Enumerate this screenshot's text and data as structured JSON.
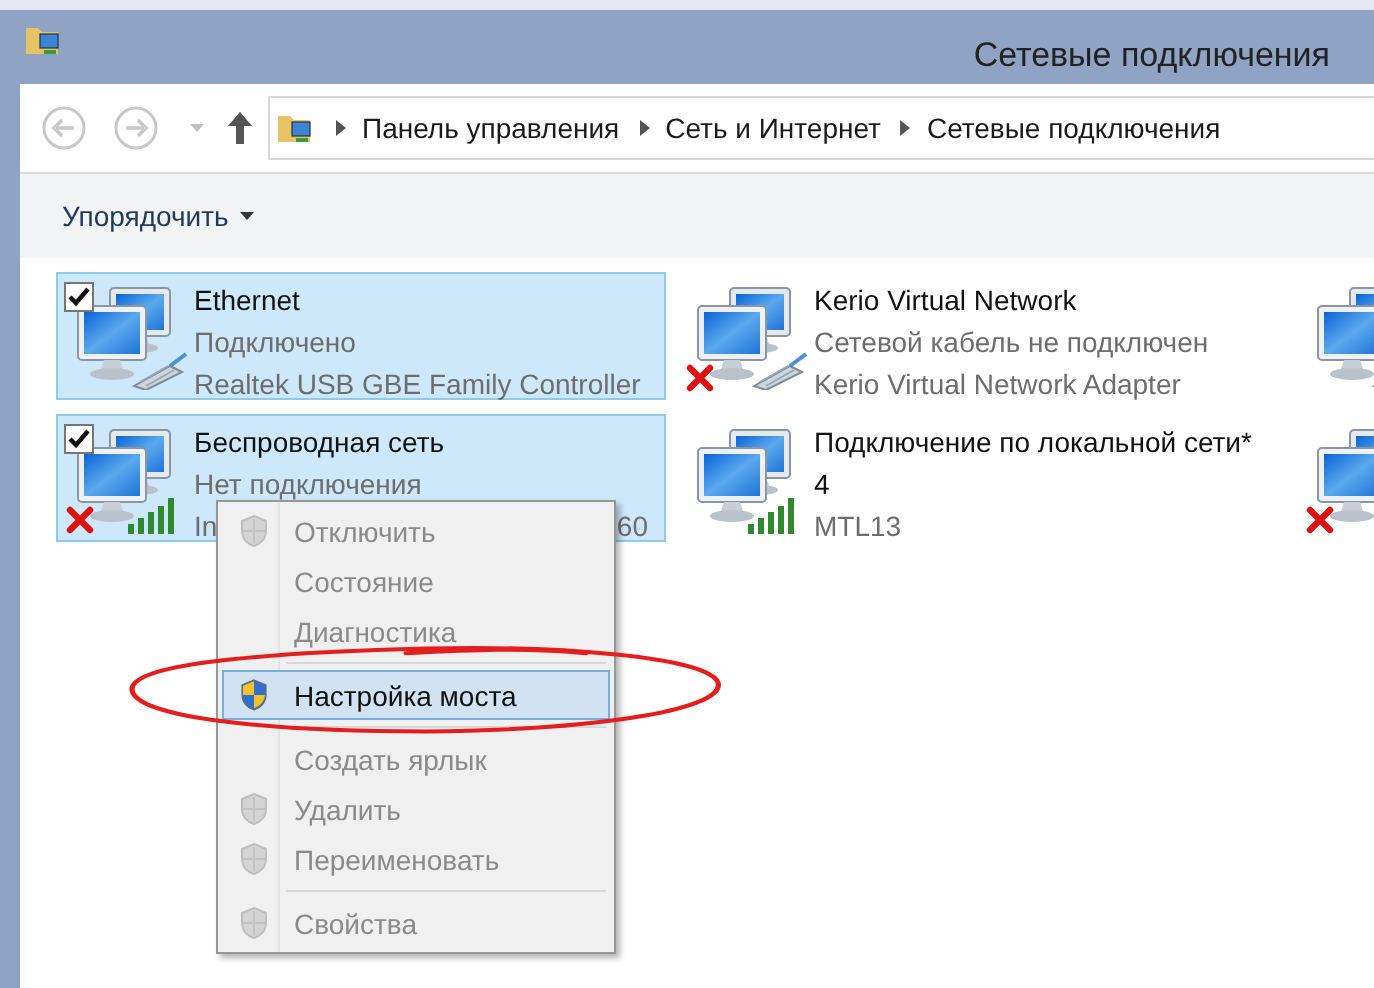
{
  "window": {
    "title": "Сетевые подключения"
  },
  "address_bar": {
    "crumbs": [
      "Панель управления",
      "Сеть и Интернет",
      "Сетевые подключения"
    ]
  },
  "toolbar": {
    "organize": "Упорядочить"
  },
  "connections": [
    {
      "name": "Ethernet",
      "status": "Подключено",
      "device": "Realtek USB GBE Family Controller",
      "kind": "cable",
      "selected": true,
      "checked": true,
      "error": false
    },
    {
      "name": "Kerio Virtual Network",
      "status": "Сетевой кабель не подключен",
      "device": "Kerio Virtual Network Adapter",
      "kind": "cable",
      "selected": false,
      "checked": false,
      "error": true
    },
    {
      "kind": "cable",
      "selected": false,
      "checked": false,
      "error": false
    },
    {
      "name": "Беспроводная сеть",
      "status": "Нет подключения",
      "device": "In",
      "device_tail": "60",
      "kind": "wifi",
      "selected": true,
      "checked": true,
      "error": true
    },
    {
      "name": "Подключение по локальной сети* 4",
      "status": "MTL13",
      "kind": "wifi",
      "selected": false,
      "checked": false,
      "error": false
    },
    {
      "kind": "unknown",
      "selected": false,
      "checked": false,
      "error": true
    }
  ],
  "context_menu": {
    "items": [
      {
        "kind": "item",
        "label": "Отключить",
        "shield": true,
        "disabled": true,
        "selected": false
      },
      {
        "kind": "item",
        "label": "Состояние",
        "shield": false,
        "disabled": true,
        "selected": false
      },
      {
        "kind": "item",
        "label": "Диагностика",
        "shield": false,
        "disabled": true,
        "selected": false
      },
      {
        "kind": "separator"
      },
      {
        "kind": "item",
        "label": "Настройка моста",
        "shield": true,
        "disabled": false,
        "selected": true
      },
      {
        "kind": "separator"
      },
      {
        "kind": "item",
        "label": "Создать ярлык",
        "shield": false,
        "disabled": true,
        "selected": false
      },
      {
        "kind": "item",
        "label": "Удалить",
        "shield": true,
        "disabled": true,
        "selected": false
      },
      {
        "kind": "item",
        "label": "Переименовать",
        "shield": true,
        "disabled": true,
        "selected": false
      },
      {
        "kind": "separator"
      },
      {
        "kind": "item",
        "label": "Свойства",
        "shield": true,
        "disabled": true,
        "selected": false
      }
    ]
  },
  "annotation": {
    "kind": "ellipse"
  }
}
